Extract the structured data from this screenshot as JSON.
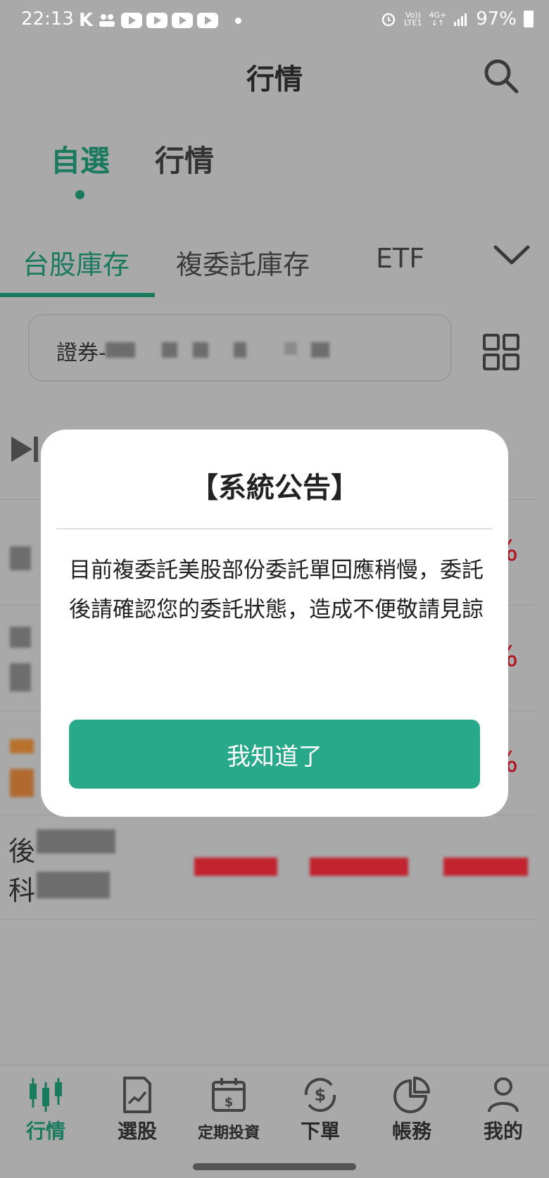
{
  "status_bar": {
    "time": "22:13",
    "k_icon": "K",
    "network_top": "Vo))",
    "network_bottom": "LTE1",
    "network2_top": "4G+",
    "battery": "97%"
  },
  "header": {
    "title": "行情"
  },
  "main_tabs": [
    {
      "label": "自選"
    },
    {
      "label": "行情"
    }
  ],
  "sub_tabs": [
    {
      "label": "台股庫存"
    },
    {
      "label": "複委託庫存"
    },
    {
      "label": "ETF"
    }
  ],
  "account": {
    "label": "證券-"
  },
  "rows": [
    {
      "pct": "%"
    },
    {
      "pct": "%"
    },
    {
      "pct": "%"
    },
    {
      "name1": "後",
      "name2": "科"
    }
  ],
  "dialog": {
    "title": "【系統公告】",
    "body": "目前複委託美股部份委託單回應稍慢，委託後請確認您的委託狀態，造成不便敬請見諒",
    "button": "我知道了"
  },
  "bottom_nav": [
    {
      "label": "行情",
      "icon": "candlestick-icon"
    },
    {
      "label": "選股",
      "icon": "stock-pick-icon"
    },
    {
      "label": "定期投資",
      "icon": "calendar-dollar-icon"
    },
    {
      "label": "下單",
      "icon": "order-dollar-icon"
    },
    {
      "label": "帳務",
      "icon": "pie-chart-icon"
    },
    {
      "label": "我的",
      "icon": "person-icon"
    }
  ],
  "colors": {
    "accent": "#1a7a5e",
    "button": "#28a98a",
    "overlay": "#a9a9a9",
    "up_red": "#b10f1c"
  }
}
